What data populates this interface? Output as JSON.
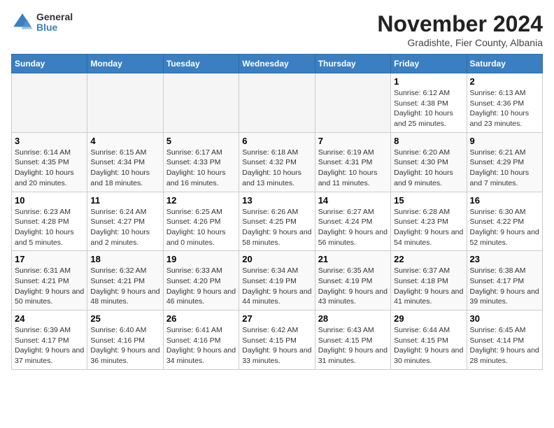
{
  "logo": {
    "general": "General",
    "blue": "Blue"
  },
  "title": "November 2024",
  "subtitle": "Gradishte, Fier County, Albania",
  "days_header": [
    "Sunday",
    "Monday",
    "Tuesday",
    "Wednesday",
    "Thursday",
    "Friday",
    "Saturday"
  ],
  "weeks": [
    [
      {
        "day": "",
        "sunrise": "",
        "sunset": "",
        "daylight": ""
      },
      {
        "day": "",
        "sunrise": "",
        "sunset": "",
        "daylight": ""
      },
      {
        "day": "",
        "sunrise": "",
        "sunset": "",
        "daylight": ""
      },
      {
        "day": "",
        "sunrise": "",
        "sunset": "",
        "daylight": ""
      },
      {
        "day": "",
        "sunrise": "",
        "sunset": "",
        "daylight": ""
      },
      {
        "day": "1",
        "sunrise": "Sunrise: 6:12 AM",
        "sunset": "Sunset: 4:38 PM",
        "daylight": "Daylight: 10 hours and 25 minutes."
      },
      {
        "day": "2",
        "sunrise": "Sunrise: 6:13 AM",
        "sunset": "Sunset: 4:36 PM",
        "daylight": "Daylight: 10 hours and 23 minutes."
      }
    ],
    [
      {
        "day": "3",
        "sunrise": "Sunrise: 6:14 AM",
        "sunset": "Sunset: 4:35 PM",
        "daylight": "Daylight: 10 hours and 20 minutes."
      },
      {
        "day": "4",
        "sunrise": "Sunrise: 6:15 AM",
        "sunset": "Sunset: 4:34 PM",
        "daylight": "Daylight: 10 hours and 18 minutes."
      },
      {
        "day": "5",
        "sunrise": "Sunrise: 6:17 AM",
        "sunset": "Sunset: 4:33 PM",
        "daylight": "Daylight: 10 hours and 16 minutes."
      },
      {
        "day": "6",
        "sunrise": "Sunrise: 6:18 AM",
        "sunset": "Sunset: 4:32 PM",
        "daylight": "Daylight: 10 hours and 13 minutes."
      },
      {
        "day": "7",
        "sunrise": "Sunrise: 6:19 AM",
        "sunset": "Sunset: 4:31 PM",
        "daylight": "Daylight: 10 hours and 11 minutes."
      },
      {
        "day": "8",
        "sunrise": "Sunrise: 6:20 AM",
        "sunset": "Sunset: 4:30 PM",
        "daylight": "Daylight: 10 hours and 9 minutes."
      },
      {
        "day": "9",
        "sunrise": "Sunrise: 6:21 AM",
        "sunset": "Sunset: 4:29 PM",
        "daylight": "Daylight: 10 hours and 7 minutes."
      }
    ],
    [
      {
        "day": "10",
        "sunrise": "Sunrise: 6:23 AM",
        "sunset": "Sunset: 4:28 PM",
        "daylight": "Daylight: 10 hours and 5 minutes."
      },
      {
        "day": "11",
        "sunrise": "Sunrise: 6:24 AM",
        "sunset": "Sunset: 4:27 PM",
        "daylight": "Daylight: 10 hours and 2 minutes."
      },
      {
        "day": "12",
        "sunrise": "Sunrise: 6:25 AM",
        "sunset": "Sunset: 4:26 PM",
        "daylight": "Daylight: 10 hours and 0 minutes."
      },
      {
        "day": "13",
        "sunrise": "Sunrise: 6:26 AM",
        "sunset": "Sunset: 4:25 PM",
        "daylight": "Daylight: 9 hours and 58 minutes."
      },
      {
        "day": "14",
        "sunrise": "Sunrise: 6:27 AM",
        "sunset": "Sunset: 4:24 PM",
        "daylight": "Daylight: 9 hours and 56 minutes."
      },
      {
        "day": "15",
        "sunrise": "Sunrise: 6:28 AM",
        "sunset": "Sunset: 4:23 PM",
        "daylight": "Daylight: 9 hours and 54 minutes."
      },
      {
        "day": "16",
        "sunrise": "Sunrise: 6:30 AM",
        "sunset": "Sunset: 4:22 PM",
        "daylight": "Daylight: 9 hours and 52 minutes."
      }
    ],
    [
      {
        "day": "17",
        "sunrise": "Sunrise: 6:31 AM",
        "sunset": "Sunset: 4:21 PM",
        "daylight": "Daylight: 9 hours and 50 minutes."
      },
      {
        "day": "18",
        "sunrise": "Sunrise: 6:32 AM",
        "sunset": "Sunset: 4:21 PM",
        "daylight": "Daylight: 9 hours and 48 minutes."
      },
      {
        "day": "19",
        "sunrise": "Sunrise: 6:33 AM",
        "sunset": "Sunset: 4:20 PM",
        "daylight": "Daylight: 9 hours and 46 minutes."
      },
      {
        "day": "20",
        "sunrise": "Sunrise: 6:34 AM",
        "sunset": "Sunset: 4:19 PM",
        "daylight": "Daylight: 9 hours and 44 minutes."
      },
      {
        "day": "21",
        "sunrise": "Sunrise: 6:35 AM",
        "sunset": "Sunset: 4:19 PM",
        "daylight": "Daylight: 9 hours and 43 minutes."
      },
      {
        "day": "22",
        "sunrise": "Sunrise: 6:37 AM",
        "sunset": "Sunset: 4:18 PM",
        "daylight": "Daylight: 9 hours and 41 minutes."
      },
      {
        "day": "23",
        "sunrise": "Sunrise: 6:38 AM",
        "sunset": "Sunset: 4:17 PM",
        "daylight": "Daylight: 9 hours and 39 minutes."
      }
    ],
    [
      {
        "day": "24",
        "sunrise": "Sunrise: 6:39 AM",
        "sunset": "Sunset: 4:17 PM",
        "daylight": "Daylight: 9 hours and 37 minutes."
      },
      {
        "day": "25",
        "sunrise": "Sunrise: 6:40 AM",
        "sunset": "Sunset: 4:16 PM",
        "daylight": "Daylight: 9 hours and 36 minutes."
      },
      {
        "day": "26",
        "sunrise": "Sunrise: 6:41 AM",
        "sunset": "Sunset: 4:16 PM",
        "daylight": "Daylight: 9 hours and 34 minutes."
      },
      {
        "day": "27",
        "sunrise": "Sunrise: 6:42 AM",
        "sunset": "Sunset: 4:15 PM",
        "daylight": "Daylight: 9 hours and 33 minutes."
      },
      {
        "day": "28",
        "sunrise": "Sunrise: 6:43 AM",
        "sunset": "Sunset: 4:15 PM",
        "daylight": "Daylight: 9 hours and 31 minutes."
      },
      {
        "day": "29",
        "sunrise": "Sunrise: 6:44 AM",
        "sunset": "Sunset: 4:15 PM",
        "daylight": "Daylight: 9 hours and 30 minutes."
      },
      {
        "day": "30",
        "sunrise": "Sunrise: 6:45 AM",
        "sunset": "Sunset: 4:14 PM",
        "daylight": "Daylight: 9 hours and 28 minutes."
      }
    ]
  ]
}
